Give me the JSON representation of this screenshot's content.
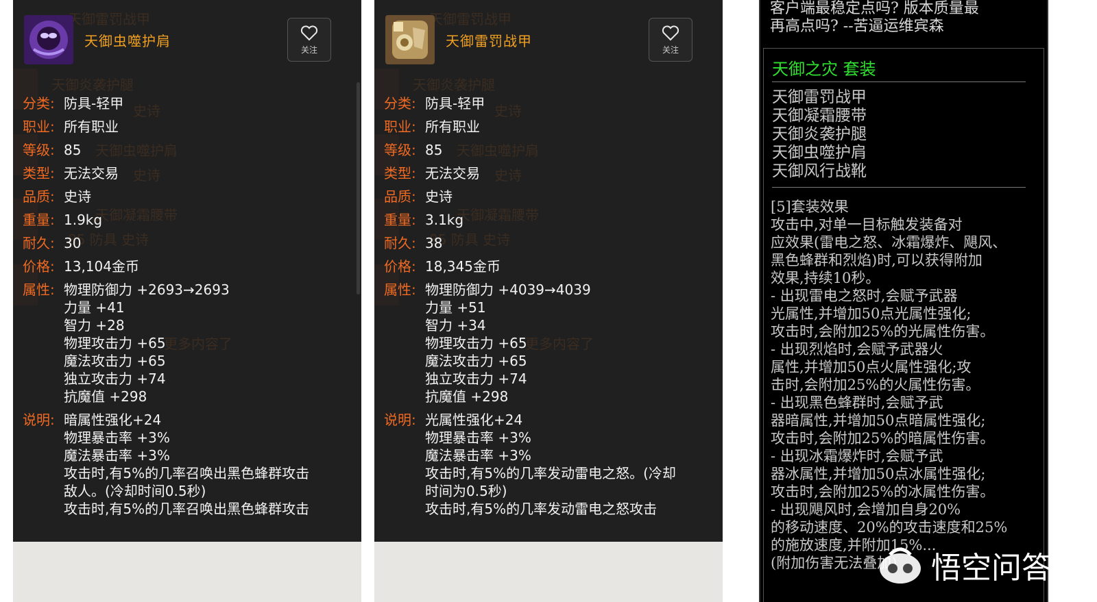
{
  "cards": [
    {
      "item_name": "天御虫噬护肩",
      "fav_label": "关注",
      "ghost_texts": [
        "天御雷罚战甲",
        "天御炎袭护腿",
        "史诗",
        "天御虫噬护肩",
        "史诗",
        "天御凝霜腰带",
        "85 防具 史诗",
        "更多内容了"
      ],
      "stats": [
        {
          "k": "分类:",
          "v": [
            "防具-轻甲"
          ]
        },
        {
          "k": "职业:",
          "v": [
            "所有职业"
          ]
        },
        {
          "k": "等级:",
          "v": [
            "85"
          ]
        },
        {
          "k": "类型:",
          "v": [
            "无法交易"
          ]
        },
        {
          "k": "品质:",
          "v": [
            "史诗"
          ]
        },
        {
          "k": "重量:",
          "v": [
            "1.9kg"
          ]
        },
        {
          "k": "耐久:",
          "v": [
            "30"
          ]
        },
        {
          "k": "价格:",
          "v": [
            "13,104金币"
          ]
        },
        {
          "k": "属性:",
          "v": [
            "物理防御力 +2693→2693",
            "力量 +41",
            "智力 +28",
            "物理攻击力 +65",
            "魔法攻击力 +65",
            "独立攻击力 +74",
            "抗魔值 +298"
          ]
        },
        {
          "k": "说明:",
          "v": [
            "暗属性强化+24",
            "物理暴击率 +3%",
            "魔法暴击率 +3%",
            "攻击时,有5%的几率召唤出黑色蜂群攻击",
            "敌人。(冷却时间0.5秒)",
            "攻击时,有5%的几率召唤出黑色蜂群攻击"
          ]
        }
      ]
    },
    {
      "item_name": "天御雷罚战甲",
      "fav_label": "关注",
      "ghost_texts": [
        "天御雷罚战甲",
        "天御炎袭护腿",
        "史诗",
        "天御虫噬护肩",
        "史诗",
        "天御凝霜腰带",
        "85 防具 史诗",
        "更多内容了"
      ],
      "stats": [
        {
          "k": "分类:",
          "v": [
            "防具-轻甲"
          ]
        },
        {
          "k": "职业:",
          "v": [
            "所有职业"
          ]
        },
        {
          "k": "等级:",
          "v": [
            "85"
          ]
        },
        {
          "k": "类型:",
          "v": [
            "无法交易"
          ]
        },
        {
          "k": "品质:",
          "v": [
            "史诗"
          ]
        },
        {
          "k": "重量:",
          "v": [
            "3.1kg"
          ]
        },
        {
          "k": "耐久:",
          "v": [
            "38"
          ]
        },
        {
          "k": "价格:",
          "v": [
            "18,345金币"
          ]
        },
        {
          "k": "属性:",
          "v": [
            "物理防御力 +4039→4039",
            "力量 +51",
            "智力 +34",
            "物理攻击力 +65",
            "魔法攻击力 +65",
            "独立攻击力 +74",
            "抗魔值 +298"
          ]
        },
        {
          "k": "说明:",
          "v": [
            "光属性强化+24",
            "物理暴击率 +3%",
            "魔法暴击率 +3%",
            "攻击时,有5%的几率发动雷电之怒。(冷却",
            "时间为0.5秒)",
            "攻击时,有5%的几率发动雷电之怒攻击"
          ]
        }
      ]
    }
  ],
  "right": {
    "top_lines": [
      "客户端最稳定点吗? 版本质量最",
      "再高点吗? --苦逼运维宾森"
    ],
    "set_title": "天御之灾 套装",
    "set_items": [
      "天御雷罚战甲",
      "天御凝霜腰带",
      "天御炎袭护腿",
      "天御虫噬护肩",
      "天御风行战靴"
    ],
    "effect_lines": [
      "[5]套装效果",
      "    攻击中,对单一目标触发装备对",
      "应效果(雷电之怒、冰霜爆炸、飓风、",
      "黑色蜂群和烈焰)时,可以获得附加",
      "效果,持续10秒。",
      "  - 出现雷电之怒时,会赋予武器",
      "光属性,并增加50点光属性强化;",
      "攻击时,会附加25%的光属性伤害。",
      "  - 出现烈焰时,会赋予武器火",
      "属性,并增加50点火属性强化;攻",
      "击时,会附加25%的火属性伤害。",
      "  - 出现黑色蜂群时,会赋予武",
      "器暗属性,并增加50点暗属性强化;",
      "攻击时,会附加25%的暗属性伤害。",
      "  - 出现冰霜爆炸时,会赋予武",
      "器冰属性,并增加50点冰属性强化;",
      "攻击时,会附加25%的冰属性伤害。",
      "  - 出现飓风时,会增加自身20%",
      "的移动速度、20%的攻击速度和25%",
      "的施放速度,并附加15%...",
      "(附加伤害无法叠加)"
    ],
    "watermark_text": "悟空问答"
  },
  "colors": {
    "label_orange": "#f06a22",
    "name_gold": "#f0a020",
    "set_green": "#30e030"
  }
}
